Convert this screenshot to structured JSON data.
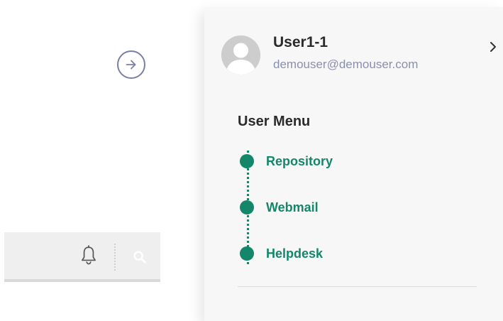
{
  "icons": {
    "arrow": "arrow-right-circle-icon",
    "bell": "bell-icon",
    "search": "search-icon",
    "avatar": "avatar-placeholder-icon",
    "chevron": "chevron-right-icon"
  },
  "user": {
    "name": "User1-1",
    "email": "demouser@demouser.com"
  },
  "user_menu": {
    "title": "User Menu",
    "items": [
      {
        "label": "Repository"
      },
      {
        "label": "Webmail"
      },
      {
        "label": "Helpdesk"
      }
    ]
  },
  "colors": {
    "accent": "#14876a",
    "email": "#8a8fb0",
    "arrow_border": "#7b7fa8"
  }
}
